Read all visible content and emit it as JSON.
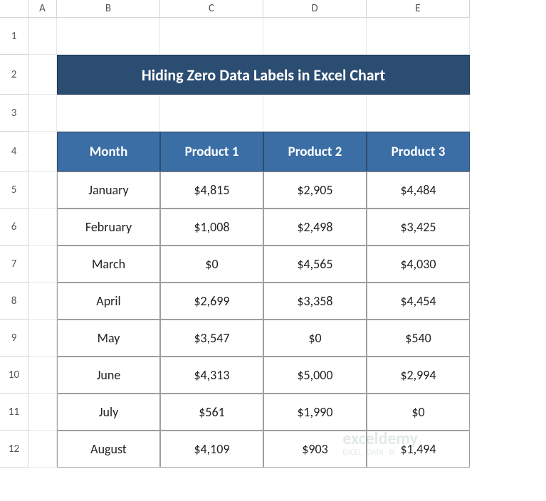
{
  "columns": [
    "A",
    "B",
    "C",
    "D",
    "E"
  ],
  "rows": [
    "1",
    "2",
    "3",
    "4",
    "5",
    "6",
    "7",
    "8",
    "9",
    "10",
    "11",
    "12"
  ],
  "title": "Hiding Zero Data Labels in Excel Chart",
  "table": {
    "headers": [
      "Month",
      "Product 1",
      "Product 2",
      "Product 3"
    ],
    "data": [
      [
        "January",
        "$4,815",
        "$2,905",
        "$4,484"
      ],
      [
        "February",
        "$1,008",
        "$2,498",
        "$3,425"
      ],
      [
        "March",
        "$0",
        "$4,565",
        "$4,030"
      ],
      [
        "April",
        "$2,699",
        "$3,358",
        "$4,454"
      ],
      [
        "May",
        "$3,547",
        "$0",
        "$540"
      ],
      [
        "June",
        "$4,313",
        "$5,000",
        "$2,994"
      ],
      [
        "July",
        "$561",
        "$1,990",
        "$0"
      ],
      [
        "August",
        "$4,109",
        "$903",
        "$1,494"
      ]
    ]
  },
  "watermark": {
    "brand": "exceldemy",
    "tagline": "EXCEL · DATA · BI"
  }
}
